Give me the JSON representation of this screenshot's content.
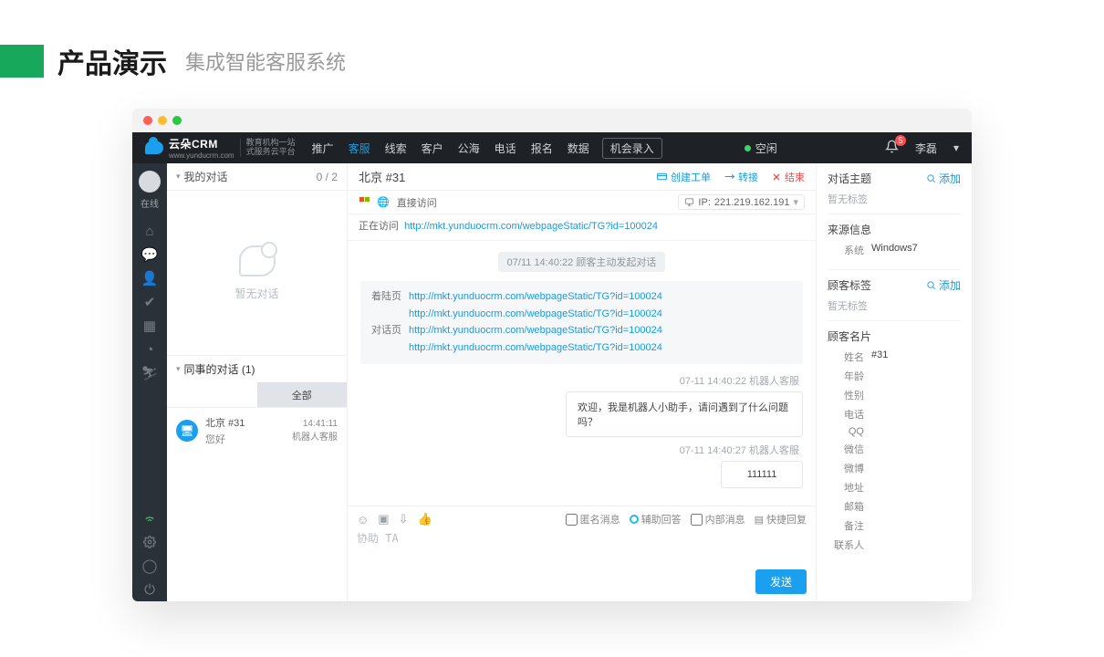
{
  "pageHeader": {
    "title": "产品演示",
    "subtitle": "集成智能客服系统"
  },
  "brand": {
    "name": "云朵CRM",
    "url": "www.yunducrm.com",
    "tagline1": "教育机构一站",
    "tagline2": "式服务云平台"
  },
  "nav": {
    "items": [
      "推广",
      "客服",
      "线索",
      "客户",
      "公海",
      "电话",
      "报名",
      "数据"
    ],
    "activeIndex": 1,
    "record": "机会录入",
    "idle": "空闲",
    "badge": "5",
    "user": "李磊"
  },
  "rail": {
    "status": "在线"
  },
  "left": {
    "my": {
      "label": "我的对话",
      "count": "0 / 2"
    },
    "empty": "暂无对话",
    "colleague": {
      "label": "同事的对话  (1)",
      "tabAll": "全部"
    },
    "item": {
      "title": "北京 #31",
      "last": "您好",
      "time": "14:41:11",
      "source": "机器人客服"
    }
  },
  "chat": {
    "title": "北京 #31",
    "actions": {
      "ticket": "创建工单",
      "transfer": "转接",
      "end": "结束"
    },
    "origin": {
      "direct": "直接访问",
      "ipLabel": "IP:",
      "ip": "221.219.162.191"
    },
    "visiting": {
      "label": "正在访问",
      "url": "http://mkt.yunduocrm.com/webpageStatic/TG?id=100024"
    },
    "chip": "07/11 14:40:22  顾客主动发起对话",
    "info": {
      "landLabel": "着陆页",
      "chatLabel": "对话页",
      "u1": "http://mkt.yunduocrm.com/webpageStatic/TG?id=100024",
      "u2": "http://mkt.yunduocrm.com/webpageStatic/TG?id=100024",
      "u3": "http://mkt.yunduocrm.com/webpageStatic/TG?id=100024",
      "u4": "http://mkt.yunduocrm.com/webpageStatic/TG?id=100024"
    },
    "msgs": {
      "m1meta": "07-11 14:40:22  机器人客服",
      "m1": "欢迎，我是机器人小助手，请问遇到了什么问题吗？",
      "m2meta": "07-11 14:40:27  机器人客服",
      "m2": "111111"
    },
    "composer": {
      "anon": "匿名消息",
      "assist": "辅助回答",
      "internal": "内部消息",
      "quick": "快捷回复",
      "placeholder": "协助 TA",
      "send": "发送"
    }
  },
  "right": {
    "topic": "对话主题",
    "add": "添加",
    "noTag": "暂无标签",
    "source": "来源信息",
    "sysLabel": "系统",
    "sysVal": "Windows7",
    "tags": "顾客标签",
    "card": "顾客名片",
    "fields": {
      "name": "姓名",
      "nameVal": "#31",
      "age": "年龄",
      "gender": "性别",
      "phone": "电话",
      "qq": "QQ",
      "wechat": "微信",
      "weibo": "微博",
      "address": "地址",
      "email": "邮箱",
      "remark": "备注",
      "contact": "联系人"
    }
  }
}
